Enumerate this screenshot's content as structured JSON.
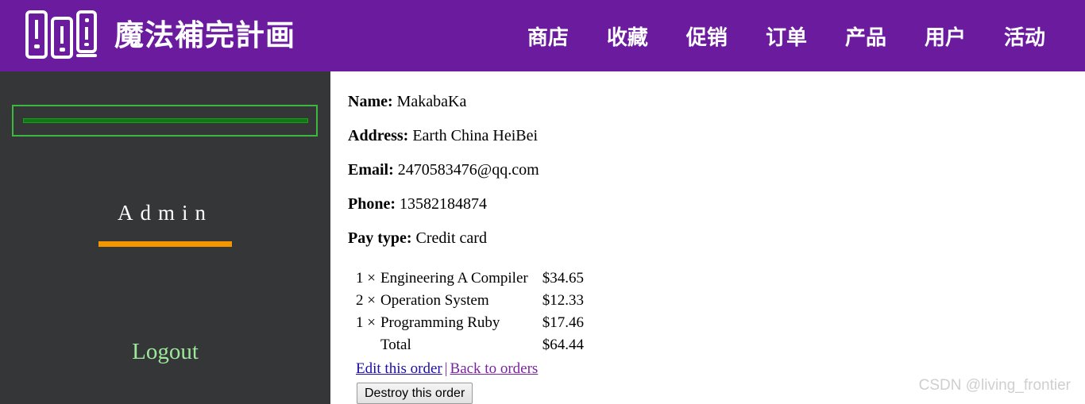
{
  "header": {
    "logo_icon": "three-books-icon",
    "brand_title": "魔法補完計画",
    "brand_color": "#6b1b9e",
    "nav": [
      {
        "label": "商店"
      },
      {
        "label": "收藏"
      },
      {
        "label": "促销"
      },
      {
        "label": "订单"
      },
      {
        "label": "产品"
      },
      {
        "label": "用户"
      },
      {
        "label": "活动"
      }
    ]
  },
  "sidebar": {
    "background_color": "#343638",
    "cart_panel": {
      "border_color": "#3cb83c",
      "bar_color": "#0e7a12"
    },
    "admin_label": "Admin",
    "admin_underline_color": "#f49600",
    "logout_label": "Logout",
    "logout_color": "#9ee89b"
  },
  "order": {
    "fields": [
      {
        "label": "Name:",
        "value": "MakabaKa"
      },
      {
        "label": "Address:",
        "value": "Earth China HeiBei"
      },
      {
        "label": "Email:",
        "value": "2470583476@qq.com"
      },
      {
        "label": "Phone:",
        "value": "13582184874"
      },
      {
        "label": "Pay type:",
        "value": "Credit card"
      }
    ],
    "line_items": [
      {
        "qty": "1 ×",
        "name": "Engineering A Compiler",
        "price": "$34.65"
      },
      {
        "qty": "2 ×",
        "name": "Operation System",
        "price": "$12.33"
      },
      {
        "qty": "1 ×",
        "name": "Programming Ruby",
        "price": "$17.46"
      }
    ],
    "total_label": "Total",
    "total_price": "$64.44",
    "links": {
      "edit": "Edit this order",
      "separator": "|",
      "back": "Back to orders",
      "edit_color": "#1a0dab",
      "back_color": "#7a23a0"
    },
    "destroy_button": "Destroy this order"
  },
  "watermark": {
    "text": "CSDN @living_frontier"
  }
}
